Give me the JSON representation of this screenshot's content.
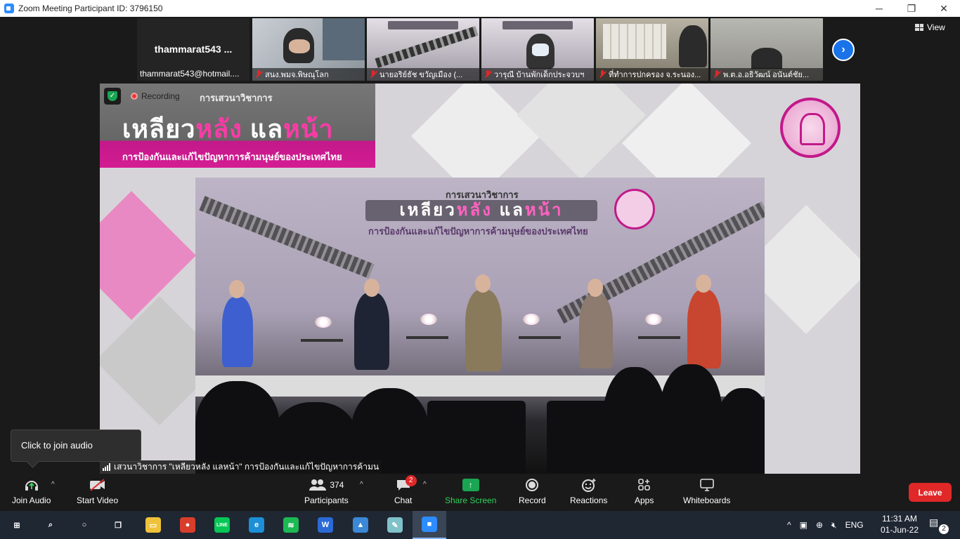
{
  "window": {
    "title": "Zoom Meeting Participant ID: 3796150",
    "minimize_icon": "minimize-icon",
    "restore_icon": "restore-icon",
    "close_icon": "close-icon"
  },
  "self_view": {
    "name": "thammarat543 ...",
    "email": "thammarat543@hotmail...."
  },
  "participants": [
    {
      "label": "สนง.พมจ.พิษณุโลก",
      "muted": true,
      "bg": "#9aa1a8"
    },
    {
      "label": "นายอริย์ธัช  ขวัญเมือง  (...",
      "muted": true,
      "bg": "#8d8a93"
    },
    {
      "label": "วารุณี บ้านพักเด็กประจวบฯ",
      "muted": true,
      "bg": "#9c97a2"
    },
    {
      "label": "ที่ทำการปกครอง จ.ระนอง...",
      "muted": true,
      "bg": "#a9a596"
    },
    {
      "label": "พ.ต.อ.อธิวัฒน์ อนันต์ชัย...",
      "muted": true,
      "bg": "#8a8a86"
    }
  ],
  "view_label": "View",
  "recording_label": "Recording",
  "presentation": {
    "banner_sub": "การเสวนาวิชาการ",
    "banner_title_white1": "เหลียว",
    "banner_title_pink1": "หลัง",
    "banner_title_white2": " แล",
    "banner_title_pink2": "หน้า",
    "banner_tagline": "การป้องกันและแก้ไขปัญหาการค้ามนุษย์ของประเทศไทย",
    "photo_sub": "การเสวนาวิชาการ",
    "photo_title_a": "เหลียว",
    "photo_title_b": "หลัง",
    "photo_title_c": " แล",
    "photo_title_d": "หน้า",
    "photo_tagline": "การป้องกันและแก้ไขปัญหาการค้ามนุษย์ของประเทศไทย"
  },
  "caption": "เสวนาวิชาการ \"เหลียวหลัง แลหน้า\" การป้องกันและแก้ไขปัญหาการค้ามน",
  "tooltip": "Click to join audio",
  "toolbar": {
    "join_audio": "Join Audio",
    "start_video": "Start Video",
    "participants": "Participants",
    "participants_count": "374",
    "chat": "Chat",
    "chat_badge": "2",
    "share_screen": "Share Screen",
    "record": "Record",
    "reactions": "Reactions",
    "apps": "Apps",
    "whiteboards": "Whiteboards",
    "leave": "Leave"
  },
  "taskbar": {
    "apps": [
      {
        "name": "start",
        "color": "#1f2733",
        "glyph": "⊞"
      },
      {
        "name": "search",
        "color": "#1f2733",
        "glyph": "⌕"
      },
      {
        "name": "cortana",
        "color": "#1f2733",
        "glyph": "○"
      },
      {
        "name": "task-view",
        "color": "#1f2733",
        "glyph": "❐"
      },
      {
        "name": "file-explorer",
        "color": "#f0c23a",
        "glyph": "▭"
      },
      {
        "name": "chrome",
        "color": "#d93d2b",
        "glyph": "●"
      },
      {
        "name": "line",
        "color": "#06c755",
        "glyph": "LINE"
      },
      {
        "name": "edge",
        "color": "#1c8fd6",
        "glyph": "e"
      },
      {
        "name": "spotify",
        "color": "#1db954",
        "glyph": "≋"
      },
      {
        "name": "webex",
        "color": "#2a6ad6",
        "glyph": "W"
      },
      {
        "name": "photos",
        "color": "#3b88d6",
        "glyph": "▲"
      },
      {
        "name": "notes",
        "color": "#7fc2c9",
        "glyph": "✎"
      },
      {
        "name": "zoom",
        "color": "#2d8cff",
        "glyph": "■"
      }
    ],
    "language": "ENG",
    "time": "11:31 AM",
    "date": "01-Jun-22",
    "notification_count": "2"
  }
}
